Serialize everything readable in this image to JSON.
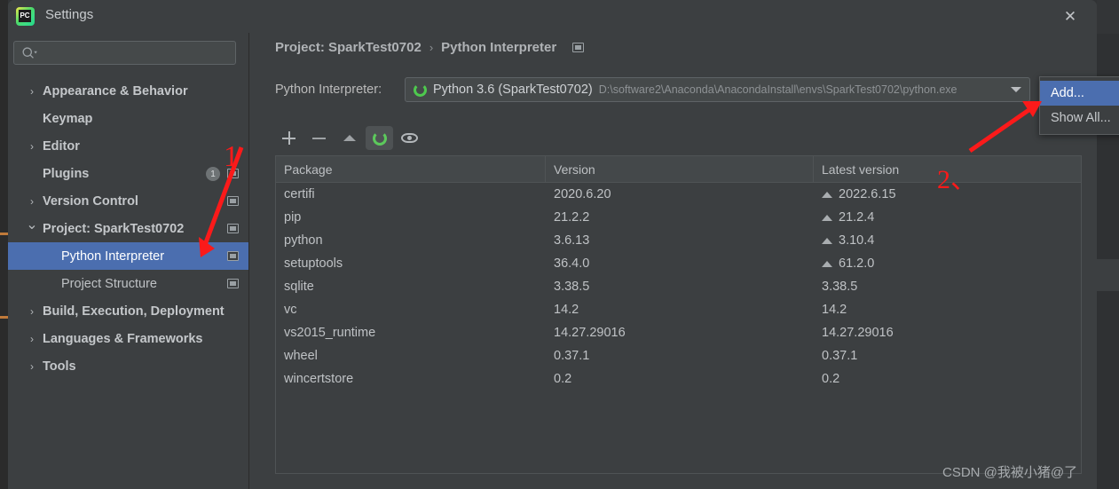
{
  "window": {
    "title": "Settings",
    "app_icon": "pycharm-icon",
    "app_icon_text": "PC",
    "close_icon": "close-icon"
  },
  "sidebar": {
    "search": {
      "placeholder": "",
      "value": "",
      "icon": "search-icon"
    },
    "items": [
      {
        "label": "Appearance & Behavior",
        "depth": 0,
        "chevron": "chevron-right",
        "selected": false,
        "project_icon": false,
        "badge": ""
      },
      {
        "label": "Keymap",
        "depth": 0,
        "chevron": "",
        "selected": false,
        "project_icon": false,
        "badge": ""
      },
      {
        "label": "Editor",
        "depth": 0,
        "chevron": "chevron-right",
        "selected": false,
        "project_icon": false,
        "badge": ""
      },
      {
        "label": "Plugins",
        "depth": 0,
        "chevron": "",
        "selected": false,
        "project_icon": true,
        "badge": "1"
      },
      {
        "label": "Version Control",
        "depth": 0,
        "chevron": "chevron-right",
        "selected": false,
        "project_icon": true,
        "badge": ""
      },
      {
        "label": "Project: SparkTest0702",
        "depth": 0,
        "chevron": "chevron-down",
        "selected": false,
        "project_icon": true,
        "badge": ""
      },
      {
        "label": "Python Interpreter",
        "depth": 1,
        "chevron": "",
        "selected": true,
        "project_icon": true,
        "badge": ""
      },
      {
        "label": "Project Structure",
        "depth": 1,
        "chevron": "",
        "selected": false,
        "project_icon": true,
        "badge": ""
      },
      {
        "label": "Build, Execution, Deployment",
        "depth": 0,
        "chevron": "chevron-right",
        "selected": false,
        "project_icon": false,
        "badge": ""
      },
      {
        "label": "Languages & Frameworks",
        "depth": 0,
        "chevron": "chevron-right",
        "selected": false,
        "project_icon": false,
        "badge": ""
      },
      {
        "label": "Tools",
        "depth": 0,
        "chevron": "chevron-right",
        "selected": false,
        "project_icon": false,
        "badge": ""
      }
    ]
  },
  "content": {
    "breadcrumb": {
      "root": "Project: SparkTest0702",
      "separator": "›",
      "leaf": "Python Interpreter",
      "icon": "project-scope-icon"
    },
    "interpreter": {
      "label": "Python Interpreter:",
      "icon": "python-env-icon",
      "name": "Python 3.6 (SparkTest0702)",
      "path": "D:\\software2\\Anaconda\\AnacondaInstall\\envs\\SparkTest0702\\python.exe",
      "dropdown_icon": "chevron-down-icon"
    },
    "interpreter_menu": {
      "items": [
        {
          "label": "Add...",
          "active": true
        },
        {
          "label": "Show All...",
          "active": false
        }
      ]
    },
    "toolbar": [
      {
        "name": "add-package-button",
        "icon": "plus-icon",
        "active": false
      },
      {
        "name": "remove-package-button",
        "icon": "minus-icon",
        "active": false
      },
      {
        "name": "upgrade-package-button",
        "icon": "up-arrow-icon",
        "active": false
      },
      {
        "name": "refresh-button",
        "icon": "loading-ring-icon",
        "active": true
      },
      {
        "name": "show-early-releases-button",
        "icon": "eye-icon",
        "active": false
      }
    ],
    "packages_table": {
      "columns": [
        "Package",
        "Version",
        "Latest version"
      ],
      "rows": [
        {
          "package": "certifi",
          "version": "2020.6.20",
          "latest": "2022.6.15",
          "upgradable": true
        },
        {
          "package": "pip",
          "version": "21.2.2",
          "latest": "21.2.4",
          "upgradable": true
        },
        {
          "package": "python",
          "version": "3.6.13",
          "latest": "3.10.4",
          "upgradable": true
        },
        {
          "package": "setuptools",
          "version": "36.4.0",
          "latest": "61.2.0",
          "upgradable": true
        },
        {
          "package": "sqlite",
          "version": "3.38.5",
          "latest": "3.38.5",
          "upgradable": false
        },
        {
          "package": "vc",
          "version": "14.2",
          "latest": "14.2",
          "upgradable": false
        },
        {
          "package": "vs2015_runtime",
          "version": "14.27.29016",
          "latest": "14.27.29016",
          "upgradable": false
        },
        {
          "package": "wheel",
          "version": "0.37.1",
          "latest": "0.37.1",
          "upgradable": false
        },
        {
          "package": "wincertstore",
          "version": "0.2",
          "latest": "0.2",
          "upgradable": false
        }
      ]
    }
  },
  "annotations": {
    "step1": "1",
    "step2": "2、",
    "color": "#fb1a1a"
  },
  "watermark": "CSDN @我被小猪@了"
}
